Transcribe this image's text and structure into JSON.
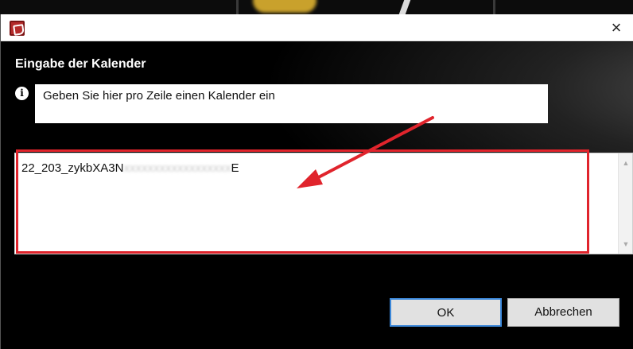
{
  "window": {
    "close_label": "×"
  },
  "dialog": {
    "heading": "Eingabe der Kalender",
    "info_icon": "i",
    "info_text": "Geben Sie hier pro Zeile einen Kalender ein",
    "textarea": {
      "visible_prefix": "22_203_zykbXA3N",
      "blurred_part": "xxxxxxxxxxxxxxxxxx",
      "visible_suffix": "E"
    },
    "ok_label": "OK",
    "cancel_label": "Abbrechen"
  },
  "colors": {
    "highlight": "#e0242c",
    "arrow": "#e0242c",
    "ok_border": "#3b87d8"
  },
  "icons": {
    "app": "app-icon",
    "info": "info-icon",
    "close": "close-icon",
    "scroll_up": "scroll-up-icon",
    "scroll_down": "scroll-down-icon"
  }
}
